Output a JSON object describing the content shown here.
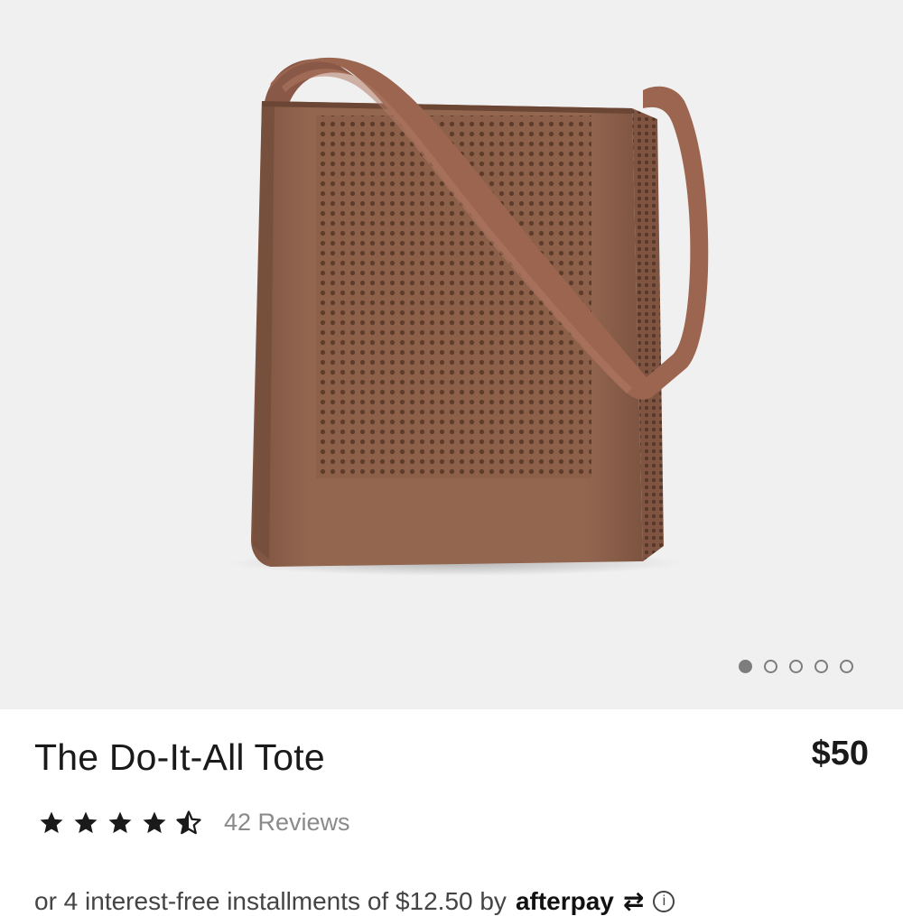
{
  "product": {
    "name": "The Do-It-All Tote",
    "price": "$50",
    "image_alt_icon": "tote-bag-image",
    "colors": {
      "bag": "#8a5e48",
      "strap": "#9a6551",
      "background": "#f0f0f0"
    }
  },
  "carousel": {
    "total": 5,
    "active_index": 0
  },
  "rating": {
    "value": 4.5,
    "max": 5,
    "reviews_label": "42 Reviews"
  },
  "afterpay": {
    "text": "or 4 interest-free installments of $12.50 by",
    "brand": "afterpay",
    "arrow": "⇄",
    "info": "i"
  }
}
